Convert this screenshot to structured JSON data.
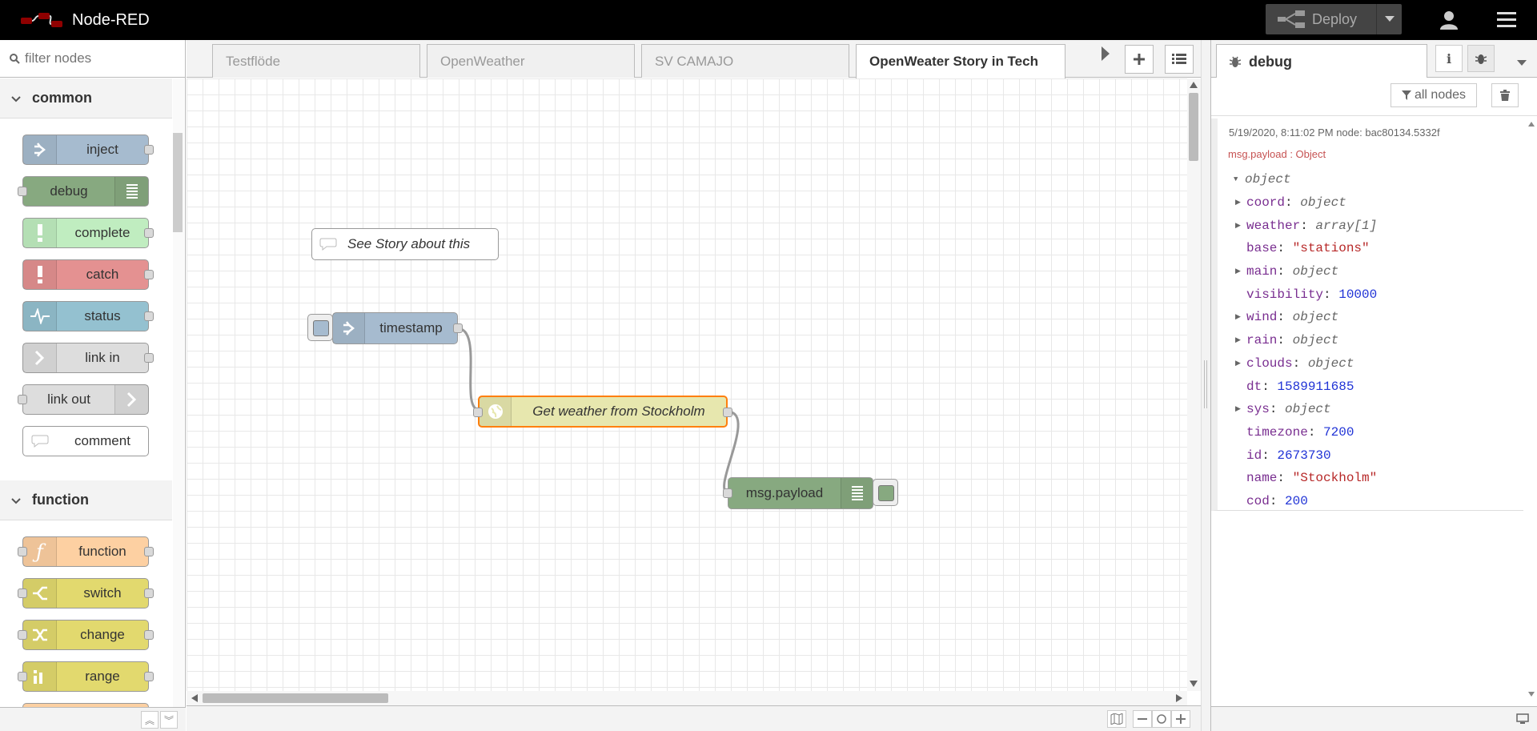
{
  "app": {
    "title": "Node-RED"
  },
  "header": {
    "deploy_label": "Deploy"
  },
  "palette": {
    "filter_placeholder": "filter nodes",
    "categories": [
      {
        "label": "common",
        "nodes": [
          {
            "label": "inject",
            "color": "#a6bbcf"
          },
          {
            "label": "debug",
            "color": "#87a980"
          },
          {
            "label": "complete",
            "color": "#c0edc0"
          },
          {
            "label": "catch",
            "color": "#e49191"
          },
          {
            "label": "status",
            "color": "#94c1d0"
          },
          {
            "label": "link in",
            "color": "#dddddd"
          },
          {
            "label": "link out",
            "color": "#dddddd"
          },
          {
            "label": "comment",
            "color": "#ffffff"
          }
        ]
      },
      {
        "label": "function",
        "nodes": [
          {
            "label": "function",
            "color": "#fdd0a2"
          },
          {
            "label": "switch",
            "color": "#e2d96e"
          },
          {
            "label": "change",
            "color": "#e2d96e"
          },
          {
            "label": "range",
            "color": "#e2d96e"
          }
        ]
      }
    ]
  },
  "workspace": {
    "tabs": [
      {
        "label": "Testflöde",
        "active": false
      },
      {
        "label": "OpenWeather",
        "active": false
      },
      {
        "label": "SV CAMAJO",
        "active": false
      },
      {
        "label": "OpenWeater Story in Tech",
        "active": true
      }
    ],
    "flow": {
      "comment": "See Story about this",
      "inject": "timestamp",
      "http": "Get weather from Stockholm",
      "debug": "msg.payload"
    }
  },
  "sidebar": {
    "tab_label": "debug",
    "filter_label": "all nodes",
    "message": {
      "meta": "5/19/2020, 8:11:02 PM   node: bac80134.5332f",
      "topic": "msg.payload : Object",
      "root": "object",
      "rows": [
        {
          "key": "coord",
          "value": "object",
          "kind": "type",
          "expandable": true
        },
        {
          "key": "weather",
          "value": "array[1]",
          "kind": "type",
          "expandable": true
        },
        {
          "key": "base",
          "value": "\"stations\"",
          "kind": "str",
          "expandable": false
        },
        {
          "key": "main",
          "value": "object",
          "kind": "type",
          "expandable": true
        },
        {
          "key": "visibility",
          "value": "10000",
          "kind": "num",
          "expandable": false
        },
        {
          "key": "wind",
          "value": "object",
          "kind": "type",
          "expandable": true
        },
        {
          "key": "rain",
          "value": "object",
          "kind": "type",
          "expandable": true
        },
        {
          "key": "clouds",
          "value": "object",
          "kind": "type",
          "expandable": true
        },
        {
          "key": "dt",
          "value": "1589911685",
          "kind": "num",
          "expandable": false
        },
        {
          "key": "sys",
          "value": "object",
          "kind": "type",
          "expandable": true
        },
        {
          "key": "timezone",
          "value": "7200",
          "kind": "num",
          "expandable": false
        },
        {
          "key": "id",
          "value": "2673730",
          "kind": "num",
          "expandable": false
        },
        {
          "key": "name",
          "value": "\"Stockholm\"",
          "kind": "str",
          "expandable": false
        },
        {
          "key": "cod",
          "value": "200",
          "kind": "num",
          "expandable": false
        }
      ]
    }
  },
  "colors": {
    "header_bg": "#000000",
    "selected_node_border": "#ff7f0e",
    "http_node": "#e7e7ae",
    "inject_node": "#a6bbcf",
    "debug_node": "#87a980"
  }
}
